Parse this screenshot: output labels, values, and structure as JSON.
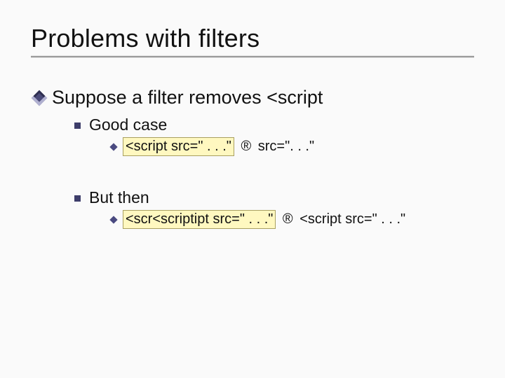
{
  "title": "Problems with filters",
  "line1": "Suppose a filter removes <script",
  "goodcase": {
    "label": "Good case",
    "hl": "<script src=\" . . .\"",
    "arrow": " ® ",
    "after": "src=\". . .\""
  },
  "butthen": {
    "label": "But then",
    "hl": "<scr<scriptipt src=\" . . .\"",
    "arrow": " ® ",
    "after": "<script src=\" . . .\""
  }
}
